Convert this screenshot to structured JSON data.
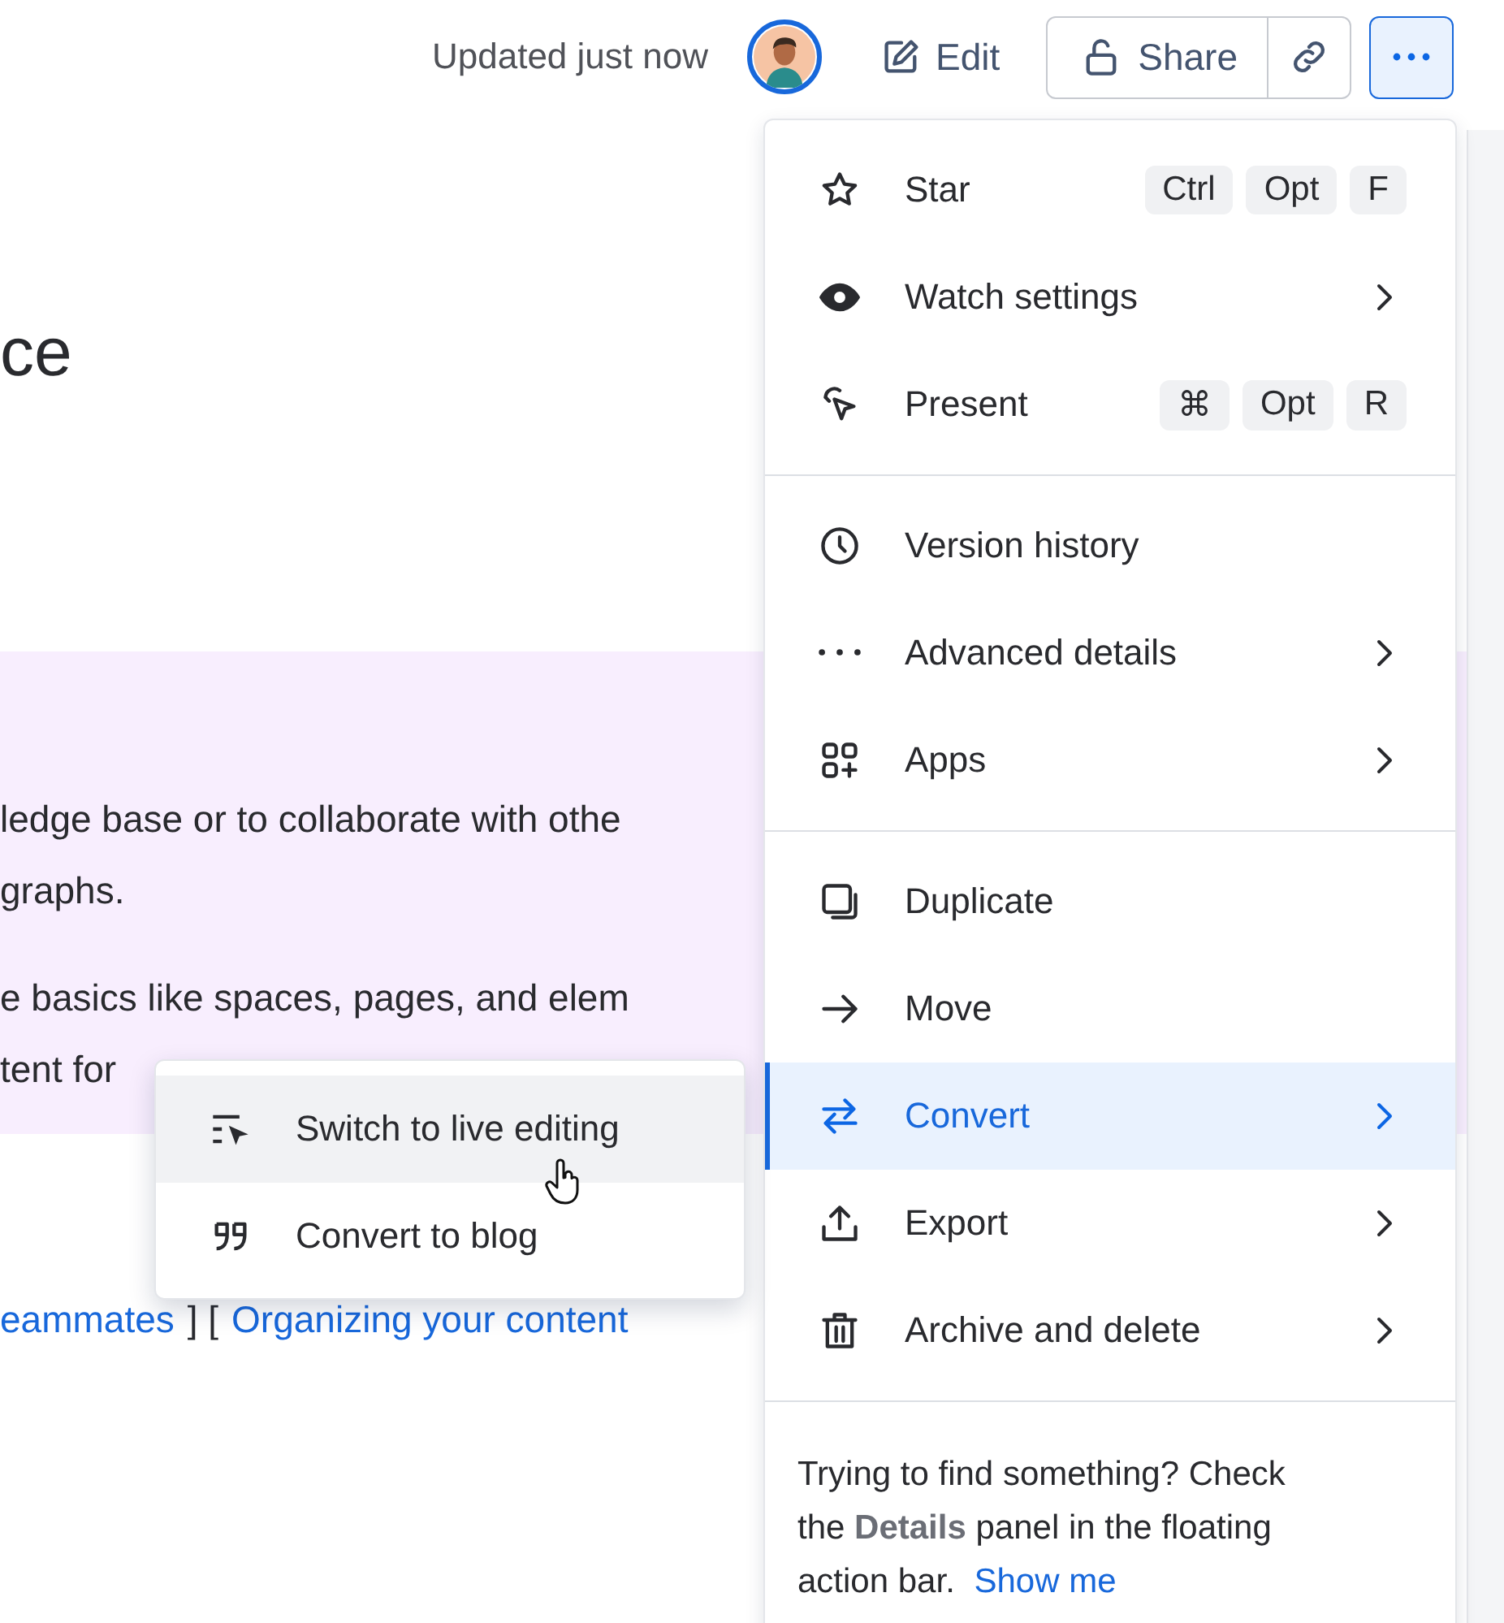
{
  "header": {
    "updated": "Updated just now",
    "edit": "Edit",
    "share": "Share"
  },
  "page": {
    "title": "ce",
    "paragraphs": [
      [
        "ledge base or to collaborate with othe",
        "graphs."
      ],
      [
        "e basics like spaces, pages, and elem",
        "tent for"
      ]
    ],
    "links": [
      {
        "text": "eammates"
      },
      {
        "text": "Organizing your content"
      }
    ],
    "link_separator": "] ["
  },
  "menu": {
    "sections": [
      {
        "items": [
          {
            "label": "Star",
            "selected": false,
            "submenu": false,
            "shortcut": [
              "Ctrl",
              "Opt",
              "F"
            ]
          },
          {
            "label": "Watch settings",
            "selected": false,
            "submenu": true
          },
          {
            "label": "Present",
            "selected": false,
            "submenu": false,
            "shortcut": [
              "⌘",
              "Opt",
              "R"
            ]
          }
        ]
      },
      {
        "items": [
          {
            "label": "Version history",
            "selected": false,
            "submenu": false
          },
          {
            "label": "Advanced details",
            "selected": false,
            "submenu": true
          },
          {
            "label": "Apps",
            "selected": false,
            "submenu": true
          }
        ]
      },
      {
        "items": [
          {
            "label": "Duplicate",
            "selected": false,
            "submenu": false
          },
          {
            "label": "Move",
            "selected": false,
            "submenu": false
          },
          {
            "label": "Convert",
            "selected": true,
            "submenu": true
          },
          {
            "label": "Export",
            "selected": false,
            "submenu": true
          },
          {
            "label": "Archive and delete",
            "selected": false,
            "submenu": true
          }
        ]
      }
    ],
    "help": "Trying to find something? Check the **Details** panel in the floating action bar.",
    "help_link": "Show me"
  },
  "submenu": {
    "items": [
      {
        "label": "Switch to live editing",
        "selected": true
      },
      {
        "label": "Convert to blog",
        "selected": false
      }
    ]
  }
}
